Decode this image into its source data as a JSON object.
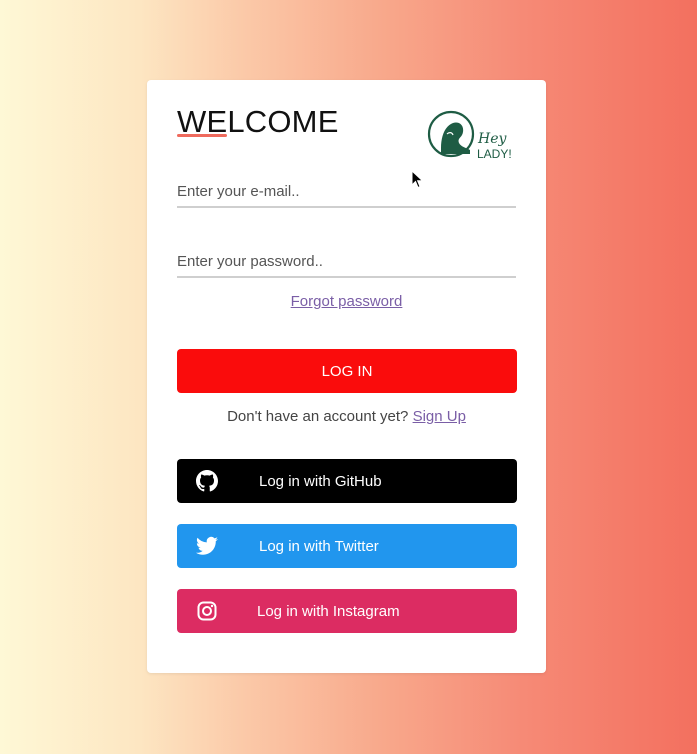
{
  "card": {
    "title": "WELCOME",
    "logo": {
      "line1": "Hey",
      "line2": "LADY!"
    },
    "email": {
      "placeholder": "Enter your e-mail..",
      "value": ""
    },
    "password": {
      "placeholder": "Enter your password..",
      "value": ""
    },
    "forgot_label": "Forgot password",
    "login_label": "LOG IN",
    "signup_prompt": "Don't have an account yet?",
    "signup_link": "Sign Up",
    "social": {
      "github_label": "Log in with GitHub",
      "twitter_label": "Log in with Twitter",
      "instagram_label": "Log in with Instagram"
    }
  },
  "icons": {
    "github": "github-icon",
    "twitter": "twitter-icon",
    "instagram": "instagram-icon",
    "logo": "hey-lady-logo",
    "cursor": "mouse-cursor"
  },
  "colors": {
    "accent": "#ef6a5d",
    "login_button": "#fa0c0c",
    "github_button": "#000000",
    "twitter_button": "#2196ee",
    "instagram_button": "#dc2c62",
    "link": "#7a5ea6",
    "logo": "#1e5c44"
  }
}
